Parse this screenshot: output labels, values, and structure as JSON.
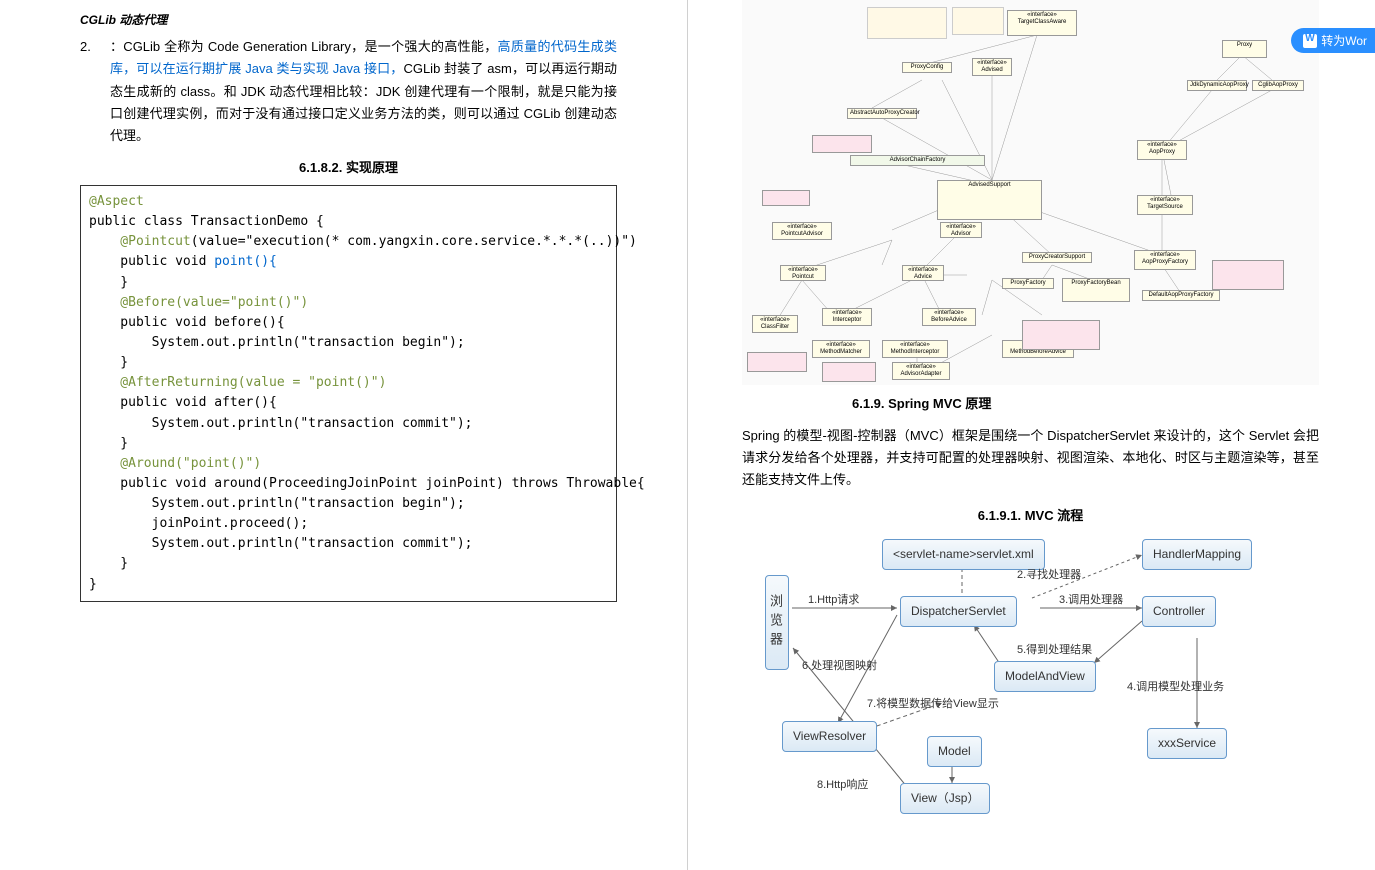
{
  "left": {
    "subtitle": "CGLib 动态代理",
    "item_num": "2.",
    "item_text_pre": "：CGLib 全称为 Code Generation Library，是一个强大的高性能，",
    "item_text_link": "高质量的代码生成类库，可以在运行期扩展 Java 类与实现 Java 接口，",
    "item_text_post": "CGLib 封装了 asm，可以再运行期动态生成新的 class。和 JDK 动态代理相比较：JDK 创建代理有一个限制，就是只能为接口创建代理实例，而对于没有通过接口定义业务方法的类，则可以通过 CGLib 创建动态代理。",
    "heading_6182": "6.1.8.2.     实现原理",
    "code": {
      "l1": "@Aspect",
      "l2": "public class TransactionDemo {",
      "l3a": "    @Pointcut",
      "l3b": "(value=\"execution(* com.yangxin.core.service.*.*.*(..))\")",
      "l4": "    public void ",
      "l4b": "point(){",
      "l5": "    }",
      "l6": "    @Before(value=\"point()\")",
      "l7": "    public void before(){",
      "l8": "        System.out.println(\"transaction begin\");",
      "l9": "    }",
      "l10": "    @AfterReturning(value = \"point()\")",
      "l11": "    public void after(){",
      "l12": "        System.out.println(\"transaction commit\");",
      "l13": "    }",
      "l14": "    @Around(\"point()\")",
      "l15": "    public void around(ProceedingJoinPoint joinPoint) throws Throwable{",
      "l16": "        System.out.println(\"transaction begin\");",
      "l17": "        joinPoint.proceed();",
      "l18": "        System.out.println(\"transaction commit\");",
      "l19": "    }",
      "l20": "}"
    }
  },
  "right": {
    "heading_619": "6.1.9.  Spring MVC 原理",
    "body": "Spring 的模型-视图-控制器（MVC）框架是围绕一个 DispatcherServlet 来设计的，这个 Servlet 会把请求分发给各个处理器，并支持可配置的处理器映射、视图渲染、本地化、时区与主题渲染等，甚至还能支持文件上传。",
    "heading_6191": "6.1.9.1.     MVC 流程",
    "mvc": {
      "browser": "浏览器",
      "config": "<servlet-name>servlet.xml",
      "dispatcher": "DispatcherServlet",
      "handler_mapping": "HandlerMapping",
      "controller": "Controller",
      "model_view": "ModelAndView",
      "service": "xxxService",
      "view_resolver": "ViewResolver",
      "model": "Model",
      "view": "View（Jsp）",
      "step1": "1.Http请求",
      "step2": "2.寻找处理器",
      "step3": "3.调用处理器",
      "step4": "4.调用模型处理业务",
      "step5": "5.得到处理结果",
      "step6": "6.处理视图映射",
      "step7": "7.将模型数据传给View显示",
      "step8": "8.Http响应"
    },
    "uml": {
      "target_class_aware": "«interface»\nTargetClassAware",
      "proxy_config": "ProxyConfig",
      "advised": "«interface»\nAdvised",
      "abstract_auto": "AbstractAutoProxyCreator",
      "advisor_chain": "AdvisorChainFactory",
      "advised_support": "AdvisedSupport",
      "advisor": "«interface»\nAdvisor",
      "advice": "«interface»\nAdvice",
      "pointcut_advisor": "«interface»\nPointcutAdvisor",
      "pointcut": "«interface»\nPointcut",
      "interceptor": "«interface»\nInterceptor",
      "before_advice": "«interface»\nBeforeAdvice",
      "class_filter": "«interface»\nClassFilter",
      "method_matcher": "«interface»\nMethodMatcher",
      "method_interceptor": "«interface»\nMethodInterceptor",
      "method_before": "«interface»\nMethodBeforeAdvice",
      "advisor_adapter": "«interface»\nAdvisorAdapter",
      "proxy_creator": "ProxyCreatorSupport",
      "proxy_factory_bean": "ProxyFactoryBean",
      "proxy_factory": "ProxyFactory",
      "proxy": "Proxy",
      "jdk_proxy": "JdkDynamicAopProxy",
      "cglib_proxy": "CglibAopProxy",
      "aop_proxy": "«interface»\nAopProxy",
      "target_source": "«interface»\nTargetSource",
      "aop_proxy_factory": "«interface»\nAopProxyFactory",
      "default_factory": "DefaultAopProxyFactory"
    }
  },
  "convert": {
    "label": "转为Wor"
  }
}
